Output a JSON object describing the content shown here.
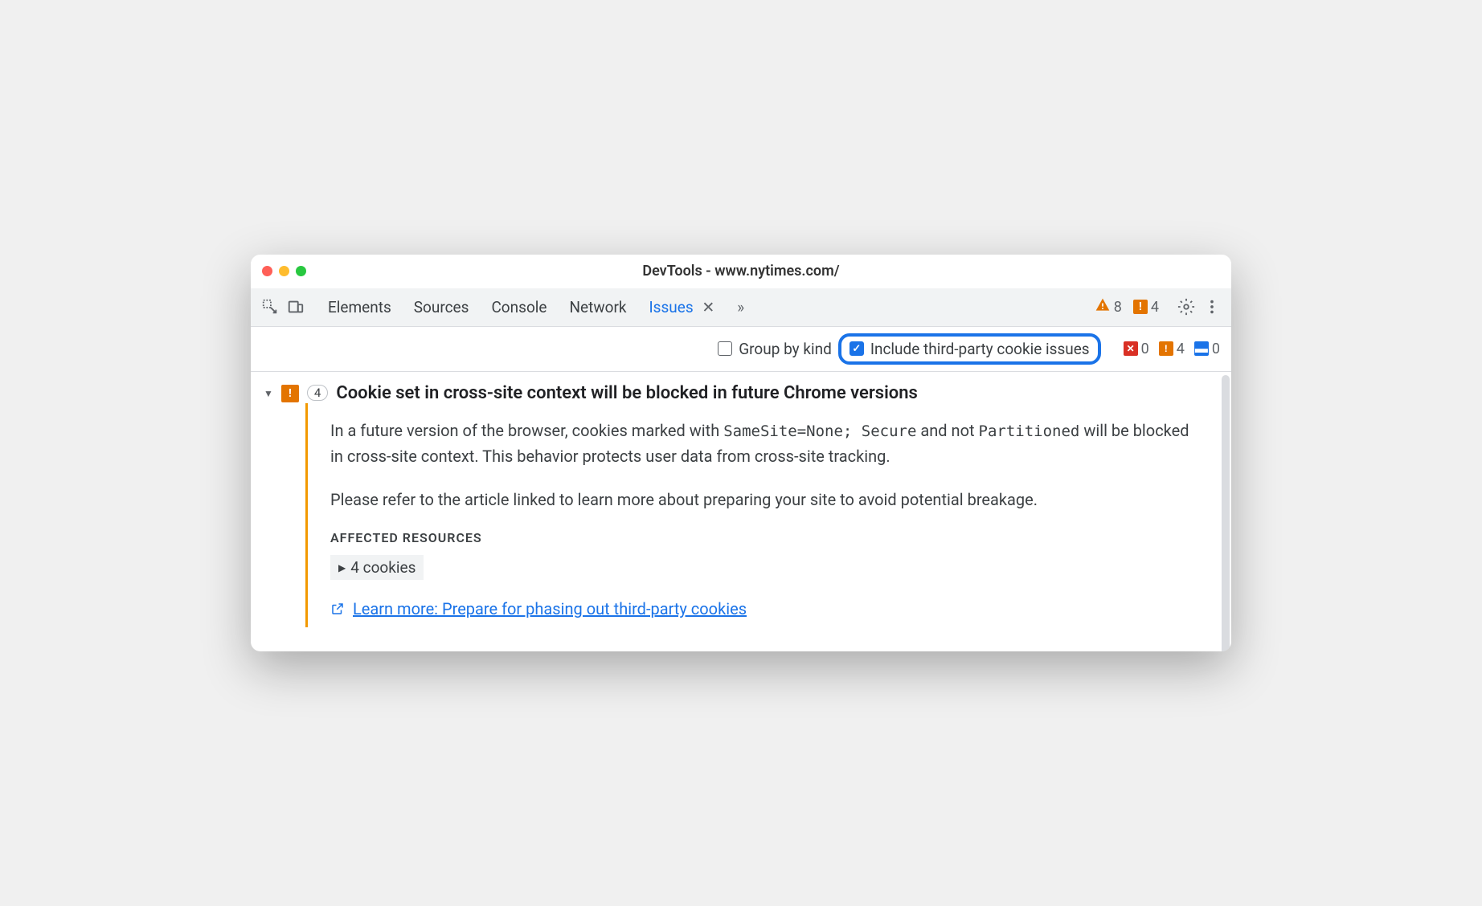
{
  "window": {
    "title": "DevTools - www.nytimes.com/"
  },
  "tabs": {
    "elements": "Elements",
    "sources": "Sources",
    "console": "Console",
    "network": "Network",
    "issues": "Issues"
  },
  "toolbar_badges": {
    "warning_count": "8",
    "breaking_count": "4"
  },
  "filters": {
    "group_by_kind": "Group by kind",
    "include_third_party": "Include third-party cookie issues"
  },
  "filter_badges": {
    "error_count": "0",
    "warning_count": "4",
    "info_count": "0"
  },
  "issue": {
    "count": "4",
    "title": "Cookie set in cross-site context will be blocked in future Chrome versions",
    "desc1_a": "In a future version of the browser, cookies marked with ",
    "desc1_code1": "SameSite=None; Secure",
    "desc1_b": " and not ",
    "desc1_code2": "Partitioned",
    "desc1_c": " will be blocked in cross-site context. This behavior protects user data from cross-site tracking.",
    "desc2": "Please refer to the article linked to learn more about preparing your site to avoid potential breakage.",
    "affected_header": "AFFECTED RESOURCES",
    "cookies_label": "4 cookies",
    "learn_more": "Learn more: Prepare for phasing out third-party cookies"
  }
}
